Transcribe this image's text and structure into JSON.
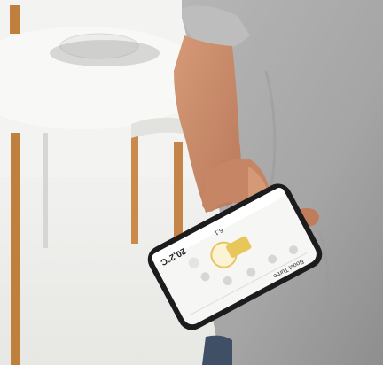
{
  "photo": {
    "colors": {
      "background": "#f3f3f1",
      "table_top": "#f7f7f5",
      "wood": "#c0803d",
      "shirt": "#a9a9a9",
      "skin": "#c98a68",
      "jeans": "#3f4f66",
      "phone_frame": "#1c1c1e",
      "screen": "#f6f6f4",
      "accent_yellow": "#e8c65a"
    }
  },
  "phone_screen": {
    "temperature": "20,2°C",
    "device_title": "Boost Turbo",
    "level": "6.1"
  }
}
